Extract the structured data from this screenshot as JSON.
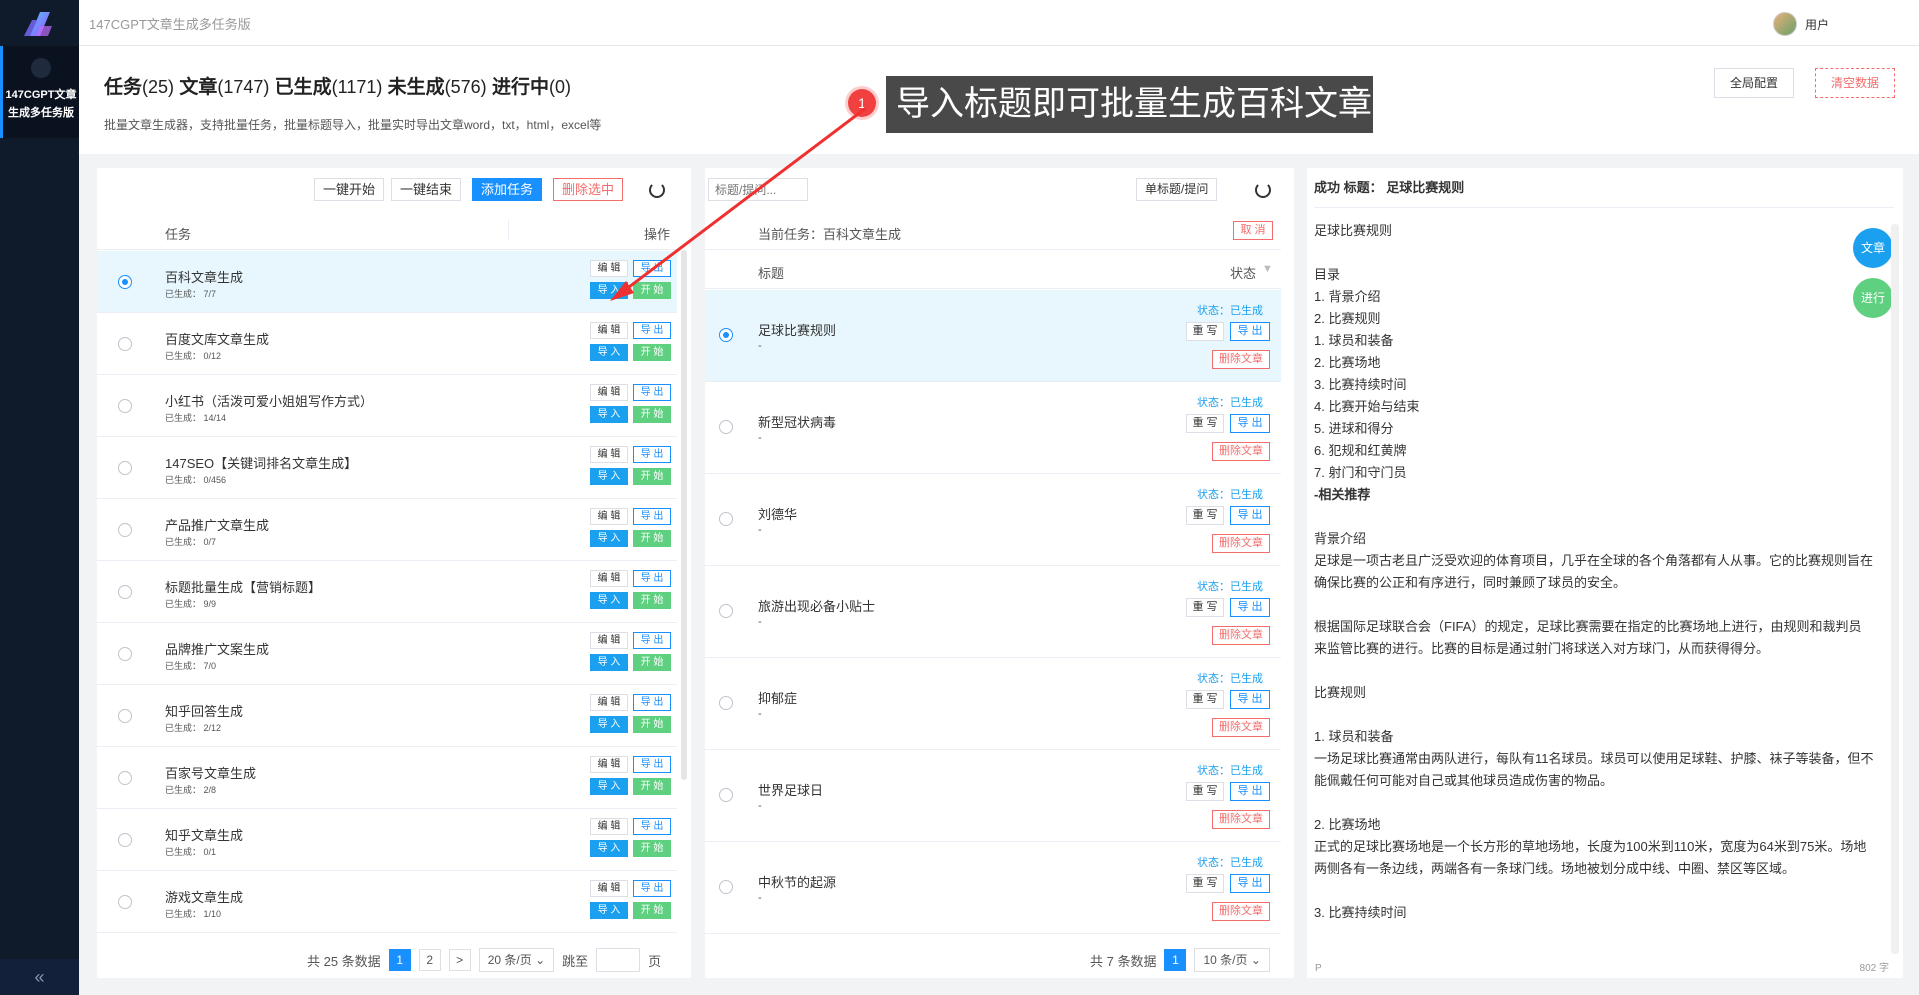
{
  "app": {
    "title": "147CGPT文章生成多任务版",
    "nav_label": "147CGPT文章生成多任务版",
    "collapse_symbol": "«"
  },
  "user": {
    "name": "用户"
  },
  "header": {
    "stats": [
      {
        "label": "任务",
        "value": "(25)"
      },
      {
        "label": "文章",
        "value": "(1747)"
      },
      {
        "label": "已生成",
        "value": "(1171)"
      },
      {
        "label": "未生成",
        "value": "(576)"
      },
      {
        "label": "进行中",
        "value": "(0)"
      }
    ],
    "description": "批量文章生成器，支持批量任务，批量标题导入，批量实时导出文章word，txt，html，excel等",
    "global_config_label": "全局配置",
    "clear_data_label": "清空数据"
  },
  "callout": {
    "number": "1",
    "text": "导入标题即可批量生成百科文章"
  },
  "tasks": {
    "toolbar": {
      "start_all": "一键开始",
      "end_all": "一键结束",
      "add_task": "添加任务",
      "delete_selected": "删除选中"
    },
    "columns": {
      "task": "任务",
      "action": "操作"
    },
    "row_buttons": {
      "edit": "编 辑",
      "export": "导 出",
      "import": "导 入",
      "start": "开 始"
    },
    "rows": [
      {
        "name": "百科文章生成",
        "sub": "已生成： 7/7",
        "selected": true
      },
      {
        "name": "百度文库文章生成",
        "sub": "已生成： 0/12",
        "selected": false
      },
      {
        "name": "小红书（活泼可爱小姐姐写作方式）",
        "sub": "已生成： 14/14",
        "selected": false
      },
      {
        "name": "147SEO【关键词排名文章生成】",
        "sub": "已生成： 0/456",
        "selected": false
      },
      {
        "name": "产品推广文章生成",
        "sub": "已生成： 0/7",
        "selected": false
      },
      {
        "name": "标题批量生成【营销标题】",
        "sub": "已生成： 9/9",
        "selected": false
      },
      {
        "name": "品牌推广文案生成",
        "sub": "已生成： 7/0",
        "selected": false
      },
      {
        "name": "知乎回答生成",
        "sub": "已生成： 2/12",
        "selected": false
      },
      {
        "name": "百家号文章生成",
        "sub": "已生成： 2/8",
        "selected": false
      },
      {
        "name": "知乎文章生成",
        "sub": "已生成： 0/1",
        "selected": false
      },
      {
        "name": "游戏文章生成",
        "sub": "已生成： 1/10",
        "selected": false
      }
    ],
    "pager": {
      "total": "共 25 条数据",
      "pages": [
        "1",
        "2"
      ],
      "next": ">",
      "page_size": "20 条/页",
      "jump_label": "跳至",
      "page_unit": "页"
    }
  },
  "titles": {
    "search_placeholder": "标题/提问...",
    "single_title_label": "单标题/提问",
    "current_task": "当前任务：百科文章生成",
    "cancel_label": "取 消",
    "columns": {
      "title": "标题",
      "status": "状态"
    },
    "row_buttons": {
      "status": "状态：已生成",
      "rewrite": "重 写",
      "export": "导 出",
      "delete": "删除文章"
    },
    "rows": [
      {
        "title": "足球比赛规则",
        "dash": "-",
        "selected": true
      },
      {
        "title": "新型冠状病毒",
        "dash": "-",
        "selected": false
      },
      {
        "title": "刘德华",
        "dash": "-",
        "selected": false
      },
      {
        "title": "旅游出现必备小贴士",
        "dash": "-",
        "selected": false
      },
      {
        "title": "抑郁症",
        "dash": "-",
        "selected": false
      },
      {
        "title": "世界足球日",
        "dash": "-",
        "selected": false
      },
      {
        "title": "中秋节的起源",
        "dash": "-",
        "selected": false
      }
    ],
    "pager": {
      "total": "共 7 条数据",
      "current": "1",
      "page_size": "10 条/页"
    }
  },
  "article": {
    "header": "成功 标题： 足球比赛规则",
    "bubble_article": "文章",
    "bubble_progress": "进行",
    "lines": [
      "足球比赛规则",
      "",
      "目录",
      "1. 背景介绍",
      "2. 比赛规则",
      "1. 球员和装备",
      "2. 比赛场地",
      "3. 比赛持续时间",
      "4. 比赛开始与结束",
      "5. 进球和得分",
      "6. 犯规和红黄牌",
      "7. 射门和守门员",
      "-相关推荐",
      "",
      "背景介绍",
      "足球是一项古老且广泛受欢迎的体育项目，几乎在全球的各个角落都有人从事。它的比赛规则旨在确保比赛的公正和有序进行，同时兼顾了球员的安全。",
      "",
      "根据国际足球联合会（FIFA）的规定，足球比赛需要在指定的比赛场地上进行，由规则和裁判员来监管比赛的进行。比赛的目标是通过射门将球送入对方球门，从而获得得分。",
      "",
      "比赛规则",
      "",
      "1. 球员和装备",
      "一场足球比赛通常由两队进行，每队有11名球员。球员可以使用足球鞋、护膝、袜子等装备，但不能佩戴任何可能对自己或其他球员造成伤害的物品。",
      "",
      "2. 比赛场地",
      "正式的足球比赛场地是一个长方形的草地场地，长度为100米到110米，宽度为64米到75米。场地两侧各有一条边线，两端各有一条球门线。场地被划分成中线、中圈、禁区等区域。",
      "",
      "3. 比赛持续时间"
    ],
    "p_marker": "P",
    "word_count": "802 字"
  },
  "colors": {
    "accent": "#1890ff",
    "danger": "#f56c6c",
    "success": "#5fcf80",
    "sidebar": "#0f1a2b",
    "callout_bg": "#494949"
  }
}
